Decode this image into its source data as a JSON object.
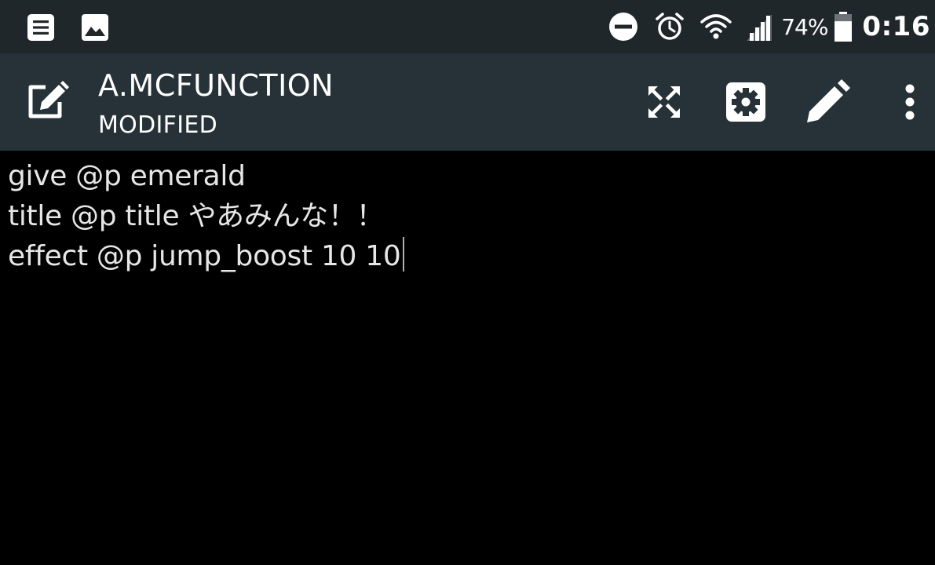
{
  "status_bar": {
    "left_icons": [
      "notes-notification-icon",
      "image-notification-icon"
    ],
    "right_icons": [
      "do-not-disturb-icon",
      "alarm-clock-icon",
      "wifi-icon",
      "cell-signal-icon"
    ],
    "battery_percent": "74%",
    "battery_level": 0.74,
    "clock": "0:16",
    "background_color": "#20272b"
  },
  "app_bar": {
    "nav_icon": "edit-note-icon",
    "title": "A.MCFUNCTION",
    "subtitle": "MODIFIED",
    "actions": [
      "fullscreen-icon",
      "settings-icon",
      "pencil-icon",
      "more-vert-icon"
    ],
    "background_color": "#263238"
  },
  "editor": {
    "background_color": "#000000",
    "text_color": "#e6e6e6",
    "lines": [
      "give @p emerald",
      "title @p title やあみんな！！",
      "effect @p jump_boost 10 10"
    ]
  }
}
